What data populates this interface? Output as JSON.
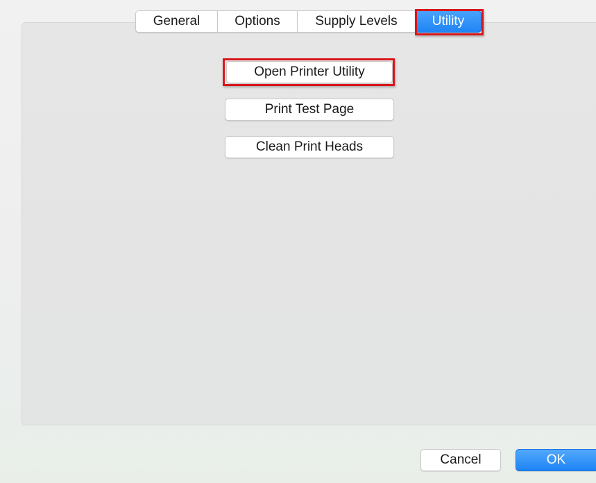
{
  "tabs": [
    {
      "label": "General",
      "selected": false
    },
    {
      "label": "Options",
      "selected": false
    },
    {
      "label": "Supply Levels",
      "selected": false
    },
    {
      "label": "Utility",
      "selected": true
    }
  ],
  "utility_panel": {
    "open_printer_utility_label": "Open Printer Utility",
    "print_test_page_label": "Print Test Page",
    "clean_print_heads_label": "Clean Print Heads"
  },
  "footer": {
    "cancel_label": "Cancel",
    "ok_label": "OK"
  },
  "colors": {
    "accent_blue": "#1f84f5",
    "highlight_red": "#d9161b",
    "panel_gray": "#e5e5e5"
  }
}
